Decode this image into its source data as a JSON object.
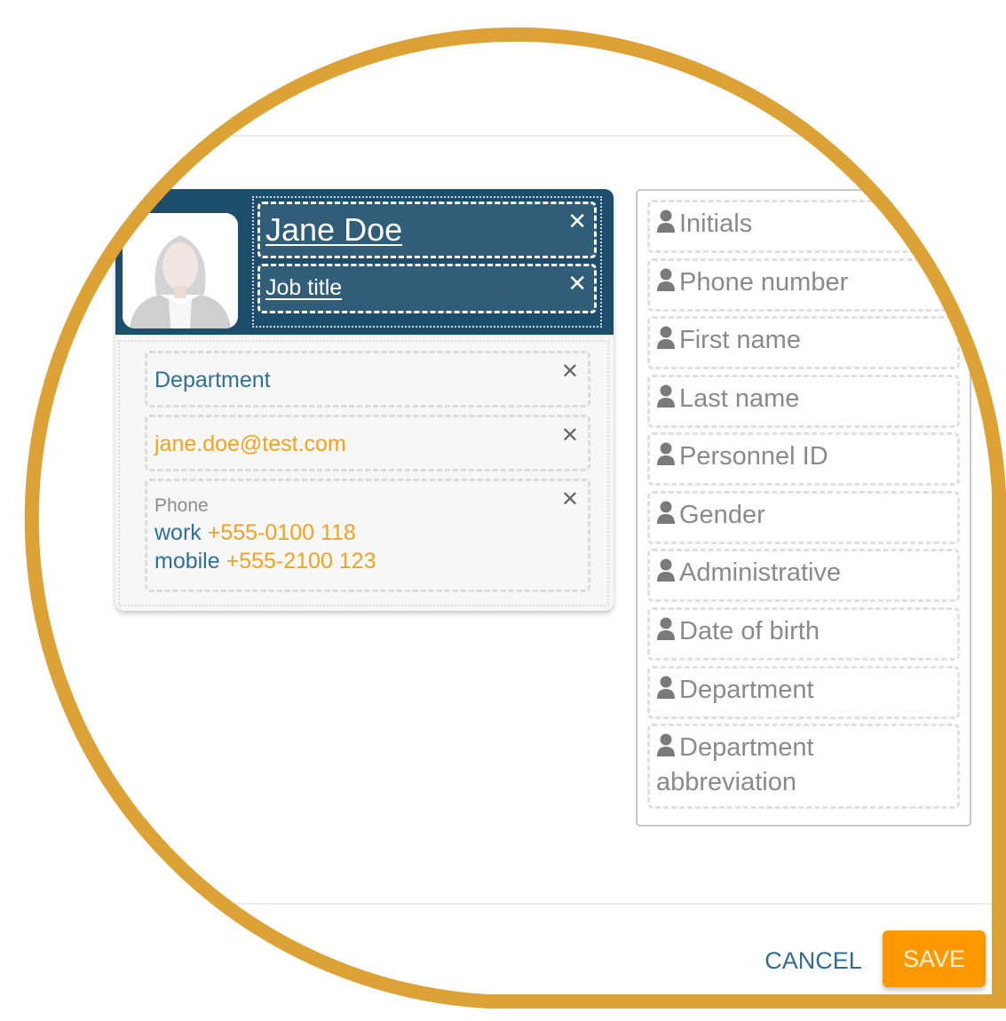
{
  "colors": {
    "lens_outline": "#DDA236",
    "header_bg": "#1C4E6B",
    "header_field_bg": "#305E78",
    "accent_blue": "#2F6F98",
    "accent_orange": "#F5A21B",
    "save_bg": "#FF9800",
    "field_label_gray": "#8A8A8A"
  },
  "card": {
    "name": "Jane Doe",
    "job_title": "Job title",
    "avatar_icon": "female-avatar-placeholder",
    "close_icon": "close-x-icon",
    "department": "Department",
    "email": "jane.doe@test.com",
    "phone": {
      "label": "Phone",
      "entries": [
        {
          "type": "work",
          "number": "+555-0100 118"
        },
        {
          "type": "mobile",
          "number": "+555-2100 123"
        }
      ]
    }
  },
  "available_fields": {
    "icon": "user-icon",
    "items": [
      {
        "label": "Initials"
      },
      {
        "label": "Phone number"
      },
      {
        "label": "First name"
      },
      {
        "label": "Last name"
      },
      {
        "label": "Personnel ID"
      },
      {
        "label": "Gender"
      },
      {
        "label": "Administrative"
      },
      {
        "label": "Date of birth"
      },
      {
        "label": "Department"
      },
      {
        "label": "Department abbreviation"
      }
    ]
  },
  "footer": {
    "cancel_label": "CANCEL",
    "save_label": "SAVE"
  }
}
